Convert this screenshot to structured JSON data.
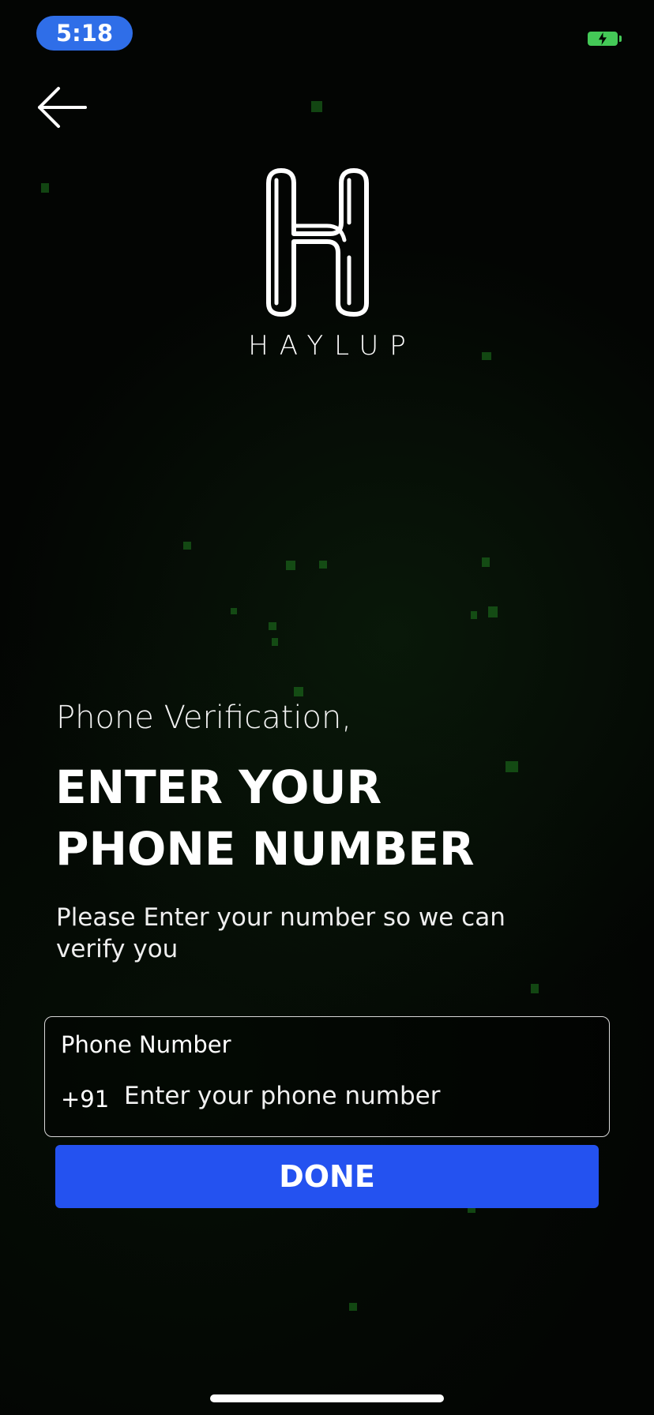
{
  "status_bar": {
    "time": "5:18",
    "battery_icon": "battery-charging-icon",
    "battery_color": "#44c957"
  },
  "navigation": {
    "back_icon": "arrow-left-icon"
  },
  "brand": {
    "logo_icon": "haylup-logo-icon",
    "name": "HAYLUP"
  },
  "content": {
    "subtitle": "Phone Verification,",
    "headline_line1": "ENTER YOUR",
    "headline_line2": "PHONE NUMBER",
    "description": "Please Enter your number so we can verify you"
  },
  "phone_field": {
    "label": "Phone Number",
    "country_code": "+91",
    "value": "",
    "placeholder": "Enter your phone number"
  },
  "actions": {
    "done_label": "DONE"
  },
  "theme": {
    "accent": "#2452f0",
    "time_pill": "#2f6ee8",
    "background": "#030503",
    "text": "#ffffff"
  }
}
